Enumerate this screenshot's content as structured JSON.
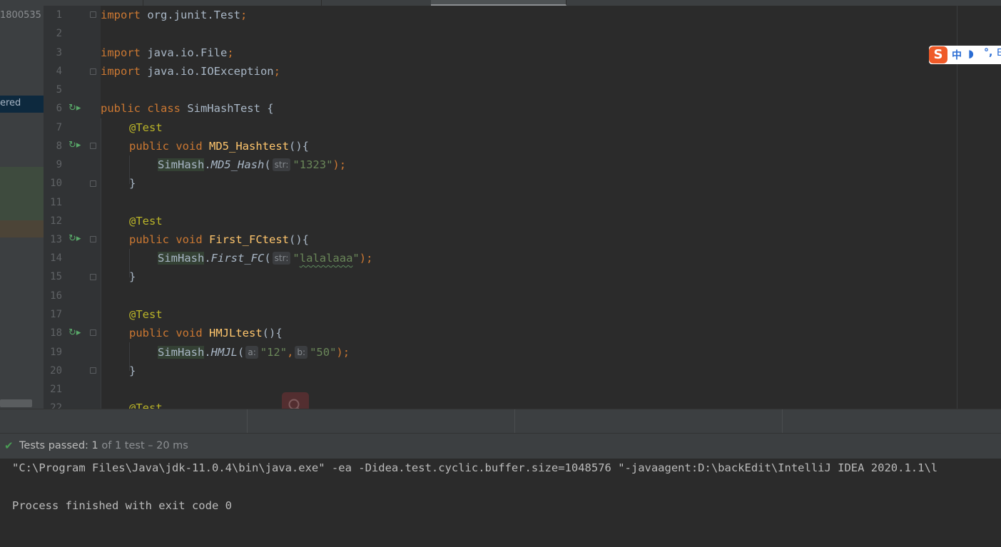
{
  "left_panel": {
    "partial_text": "1800535",
    "selected_item_partial": "ered"
  },
  "editor": {
    "lines": [
      {
        "n": "1"
      },
      {
        "n": "2"
      },
      {
        "n": "3"
      },
      {
        "n": "4"
      },
      {
        "n": "5"
      },
      {
        "n": "6"
      },
      {
        "n": "7"
      },
      {
        "n": "8"
      },
      {
        "n": "9"
      },
      {
        "n": "10"
      },
      {
        "n": "11"
      },
      {
        "n": "12"
      },
      {
        "n": "13"
      },
      {
        "n": "14"
      },
      {
        "n": "15"
      },
      {
        "n": "16"
      },
      {
        "n": "17"
      },
      {
        "n": "18"
      },
      {
        "n": "19"
      },
      {
        "n": "20"
      },
      {
        "n": "21"
      },
      {
        "n": "22"
      }
    ],
    "code": {
      "l1_kw": "import",
      "l1_rest": " org.junit.",
      "l1_cls": "Test",
      "l1_semi": ";",
      "l3_kw": "import",
      "l3_rest": " java.io.File",
      "l3_semi": ";",
      "l4_kw": "import",
      "l4_rest": " java.io.IOException",
      "l4_semi": ";",
      "l6_kw": "public class",
      "l6_rest": " SimHashTest {",
      "annotation": "@Test",
      "method_kw": "public void",
      "m1_name": "MD5_Hashtest",
      "m1_tail": "(){",
      "m1_call_cls": "SimHash",
      "m1_call_fn": "MD5_Hash",
      "m1_hint": "str:",
      "m1_arg": "\"1323\"",
      "close_brace": "}",
      "m2_name": "First_FCtest",
      "m2_tail": "(){",
      "m2_call_cls": "SimHash",
      "m2_call_fn": "First_FC",
      "m2_hint": "str:",
      "m2_arg_q1": "\"",
      "m2_arg": "lalalaaa",
      "m2_arg_q2": "\"",
      "m3_name": "HMJLtest",
      "m3_tail": "(){",
      "m3_call_cls": "SimHash",
      "m3_call_fn": "HMJL",
      "m3_hint_a": "a:",
      "m3_arg_a": "\"12\"",
      "m3_hint_b": "b:",
      "m3_arg_b": "\"50\"",
      "dot": ".",
      "paren_open": "(",
      "paren_close_semi": ");",
      "comma": ","
    }
  },
  "ime": {
    "logo": "S",
    "mode": "中",
    "moon": "◗",
    "punct": "°,",
    "tail": "E"
  },
  "run_panel": {
    "status_prefix": "Tests passed: ",
    "status_count": "1",
    "status_rest": " of 1 test – 20 ms",
    "console_lines": [
      "\"C:\\Program Files\\Java\\jdk-11.0.4\\bin\\java.exe\" -ea -Didea.test.cyclic.buffer.size=1048576 \"-javaagent:D:\\backEdit\\IntelliJ IDEA 2020.1.1\\l",
      "",
      "Process finished with exit code 0"
    ]
  },
  "colors": {
    "keyword": "#cc7832",
    "annotation": "#bbb529",
    "method": "#ffc66d",
    "string": "#6a8759",
    "plain": "#a9b7c6",
    "success": "#499c54"
  }
}
